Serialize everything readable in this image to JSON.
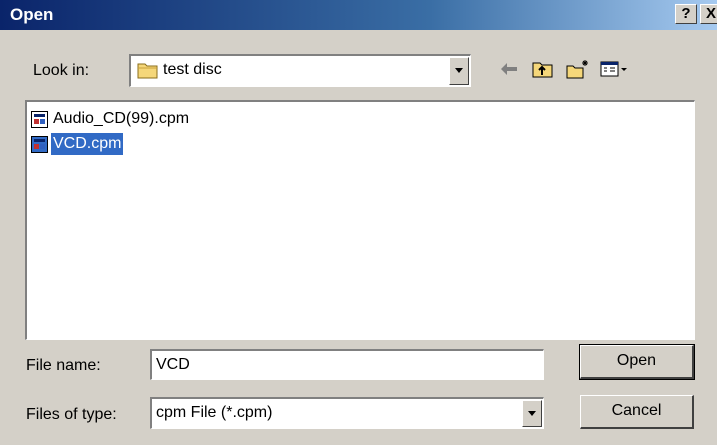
{
  "window": {
    "title": "Open",
    "help_label": "?",
    "close_label": "X"
  },
  "lookin": {
    "label": "Look in:",
    "value": "test disc"
  },
  "toolbar": {
    "icons": [
      "back-arrow-icon",
      "up-one-level-icon",
      "new-folder-icon",
      "views-menu-icon"
    ]
  },
  "files": [
    {
      "name": "Audio_CD(99).cpm",
      "selected": false
    },
    {
      "name": "VCD.cpm",
      "selected": true
    }
  ],
  "filename": {
    "label": "File name:",
    "value": "VCD"
  },
  "filetype": {
    "label": "Files of type:",
    "value": "cpm File (*.cpm)"
  },
  "buttons": {
    "open_label": "Open",
    "cancel_label": "Cancel"
  },
  "colors": {
    "selection": "#316ac5",
    "titlebar_start": "#0a246a",
    "face": "#d4d0c8"
  }
}
